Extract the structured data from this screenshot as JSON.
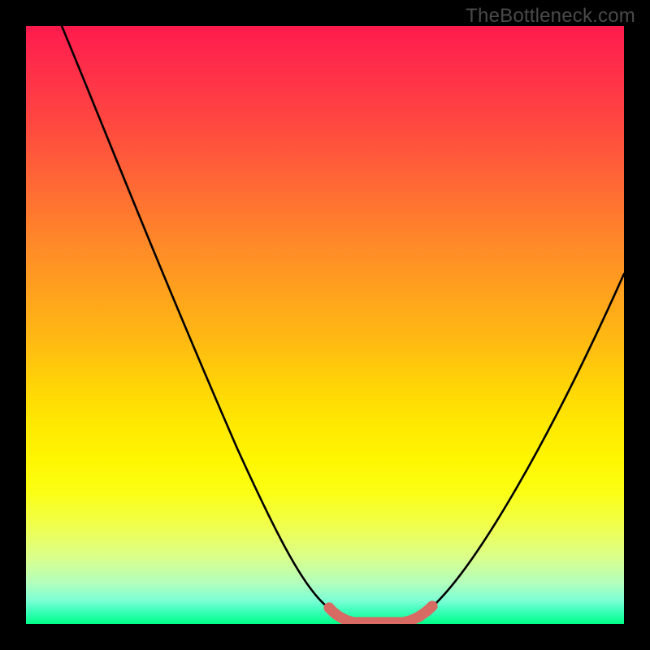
{
  "watermark": "TheBottleneck.com",
  "colors": {
    "frame": "#000000",
    "curve_stroke": "#000000",
    "marker_stroke": "#d86a64",
    "marker_fill": "#d86a64"
  },
  "chart_data": {
    "type": "line",
    "title": "",
    "xlabel": "",
    "ylabel": "",
    "xlim": [
      0,
      100
    ],
    "ylim": [
      0,
      100
    ],
    "grid": false,
    "legend": false,
    "series": [
      {
        "name": "bottleneck-curve",
        "x": [
          6,
          10,
          15,
          20,
          25,
          30,
          35,
          40,
          45,
          48,
          51,
          53,
          55,
          57,
          59,
          61,
          63,
          65,
          70,
          75,
          80,
          85,
          90,
          95,
          100
        ],
        "y": [
          100,
          91,
          80,
          69,
          58,
          47,
          36,
          26,
          15,
          8,
          3,
          1,
          0,
          0,
          0,
          0,
          1,
          3,
          9,
          17,
          25,
          33,
          42,
          50,
          59
        ]
      }
    ],
    "markers": {
      "name": "optimal-range",
      "x": [
        51,
        53,
        55,
        57,
        59,
        61,
        63,
        65
      ],
      "y": [
        3,
        1,
        0,
        0,
        0,
        0,
        1,
        3
      ]
    }
  }
}
